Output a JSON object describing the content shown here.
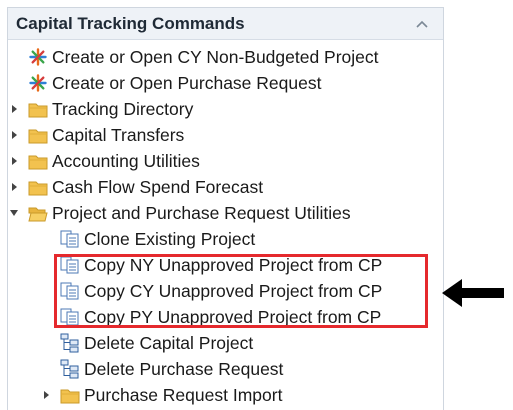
{
  "panel": {
    "title": "Capital Tracking Commands",
    "collapse_icon": "chevron-up-icon"
  },
  "tree": {
    "items": [
      {
        "label": "Create or Open CY Non-Budgeted Project",
        "icon": "burst-icon",
        "expandable": false
      },
      {
        "label": "Create or Open Purchase Request",
        "icon": "burst-icon",
        "expandable": false
      },
      {
        "label": "Tracking Directory",
        "icon": "folder-icon",
        "expandable": true,
        "expanded": false
      },
      {
        "label": "Capital Transfers",
        "icon": "folder-icon",
        "expandable": true,
        "expanded": false
      },
      {
        "label": "Accounting Utilities",
        "icon": "folder-icon",
        "expandable": true,
        "expanded": false
      },
      {
        "label": "Cash Flow Spend Forecast",
        "icon": "folder-icon",
        "expandable": true,
        "expanded": false
      },
      {
        "label": "Project and Purchase Request Utilities",
        "icon": "folder-open-icon",
        "expandable": true,
        "expanded": true
      },
      {
        "label": "Clone Existing Project",
        "icon": "document-icon",
        "expandable": false
      },
      {
        "label": "Copy NY Unapproved Project from CP",
        "icon": "document-icon",
        "expandable": false
      },
      {
        "label": "Copy CY Unapproved Project from CP",
        "icon": "document-icon",
        "expandable": false
      },
      {
        "label": "Copy PY Unapproved Project from CP",
        "icon": "document-icon",
        "expandable": false
      },
      {
        "label": "Delete Capital Project",
        "icon": "tree-delete-icon",
        "expandable": false
      },
      {
        "label": "Delete Purchase Request",
        "icon": "tree-delete-icon",
        "expandable": false
      },
      {
        "label": "Purchase Request Import",
        "icon": "folder-icon",
        "expandable": true,
        "expanded": false
      }
    ]
  },
  "annotation": {
    "highlight_color": "#e5292d",
    "arrow_color": "#000000",
    "highlighted_items": [
      "Copy NY Unapproved Project from CP",
      "Copy CY Unapproved Project from CP",
      "Copy PY Unapproved Project from CP"
    ]
  }
}
